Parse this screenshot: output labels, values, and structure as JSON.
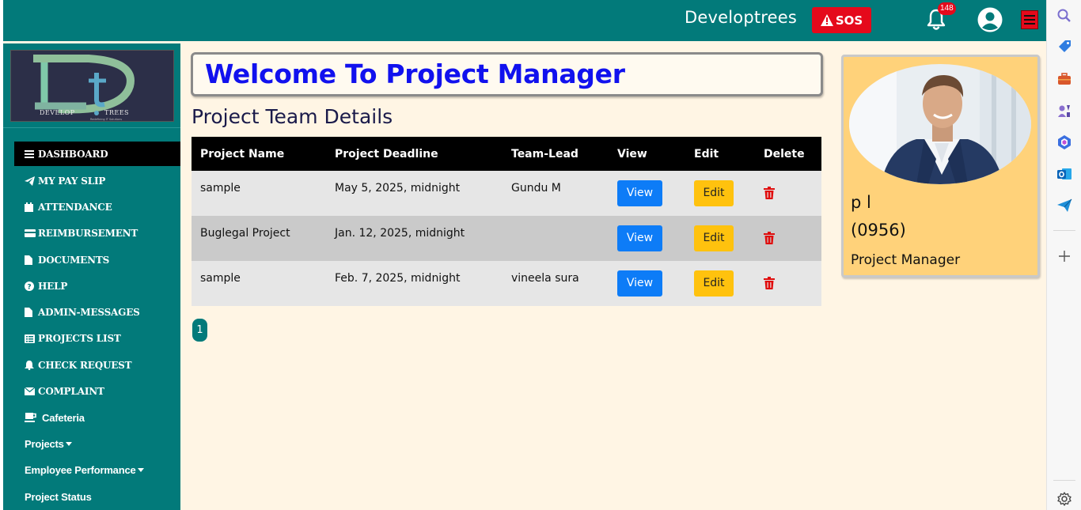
{
  "header": {
    "brand": "Developtrees",
    "sos_label": "SOS",
    "notification_count": "148"
  },
  "logo": {
    "main_text": "DEVELOP TREES",
    "tagline": "Redefining IT Solutions"
  },
  "sidebar": {
    "items": [
      {
        "label": "DASHBOARD",
        "icon": "bars-icon",
        "active": true
      },
      {
        "label": "MY PAY SLIP",
        "icon": "paper-plane-icon"
      },
      {
        "label": "ATTENDANCE",
        "icon": "calendar-icon"
      },
      {
        "label": "REIMBURSEMENT",
        "icon": "credit-card-icon"
      },
      {
        "label": "DOCUMENTS",
        "icon": "file-icon"
      },
      {
        "label": "HELP",
        "icon": "question-circle-icon"
      },
      {
        "label": "ADMIN-MESSAGES",
        "icon": "file-icon"
      },
      {
        "label": "PROJECTS LIST",
        "icon": "list-icon"
      },
      {
        "label": "CHECK REQUEST",
        "icon": "bell-icon"
      },
      {
        "label": "COMPLAINT",
        "icon": "envelope-icon"
      },
      {
        "label": "Cafeteria",
        "icon": "coffee-icon"
      },
      {
        "label": "Projects",
        "dropdown": true
      },
      {
        "label": "Employee Performance",
        "dropdown": true
      },
      {
        "label": "Project Status"
      }
    ]
  },
  "main": {
    "welcome": "Welcome To Project Manager",
    "section_title": "Project Team Details",
    "table": {
      "headers": [
        "Project Name",
        "Project Deadline",
        "Team-Lead",
        "View",
        "Edit",
        "Delete"
      ],
      "rows": [
        {
          "name": "sample",
          "deadline": "May 5, 2025, midnight",
          "lead": "Gundu M"
        },
        {
          "name": "Buglegal Project",
          "deadline": "Jan. 12, 2025, midnight",
          "lead": ""
        },
        {
          "name": "sample",
          "deadline": "Feb. 7, 2025, midnight",
          "lead": "vineela sura"
        }
      ],
      "view_label": "View",
      "edit_label": "Edit"
    },
    "pagination": {
      "current_page": "1"
    }
  },
  "profile": {
    "name": "p l",
    "employee_id": "(0956)",
    "role": "Project Manager"
  },
  "colors": {
    "teal": "#027a7a",
    "cream": "#fff5e4",
    "sos_red": "#e5091b",
    "welcome_blue": "#1111ee",
    "view_blue": "#0d7cf7",
    "edit_yellow": "#ffc20e",
    "profile_card": "#ffd27a"
  }
}
